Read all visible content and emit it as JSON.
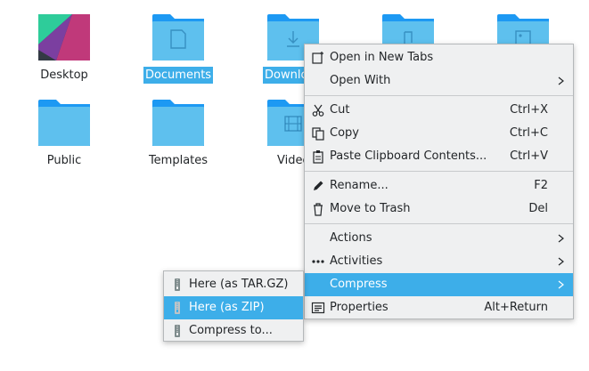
{
  "files": [
    {
      "name": "Desktop",
      "selected": false,
      "kind": "desktop"
    },
    {
      "name": "Documents",
      "selected": true,
      "kind": "documents"
    },
    {
      "name": "Downlo",
      "selected": true,
      "kind": "downloads"
    },
    {
      "name": "",
      "selected": false,
      "kind": "music"
    },
    {
      "name": "",
      "selected": false,
      "kind": "pictures"
    },
    {
      "name": "Public",
      "selected": false,
      "kind": "public"
    },
    {
      "name": "Templates",
      "selected": false,
      "kind": "templates"
    },
    {
      "name": "Videc",
      "selected": false,
      "kind": "videos"
    }
  ],
  "context_menu": {
    "items": {
      "open_tabs": {
        "label": "Open in New Tabs",
        "icon": "new-tab-icon"
      },
      "open_with": {
        "label": "Open With",
        "icon": ""
      },
      "cut": {
        "label": "Cut",
        "shortcut": "Ctrl+X",
        "icon": "scissors-icon"
      },
      "copy": {
        "label": "Copy",
        "shortcut": "Ctrl+C",
        "icon": "copy-icon"
      },
      "paste": {
        "label": "Paste Clipboard Contents...",
        "shortcut": "Ctrl+V",
        "icon": "clipboard-icon"
      },
      "rename": {
        "label": "Rename...",
        "shortcut": "F2",
        "icon": "pencil-icon"
      },
      "trash": {
        "label": "Move to Trash",
        "shortcut": "Del",
        "icon": "trash-icon"
      },
      "actions": {
        "label": "Actions",
        "icon": ""
      },
      "activities": {
        "label": "Activities",
        "icon": "activities-icon"
      },
      "compress": {
        "label": "Compress",
        "icon": "",
        "highlighted": true
      },
      "properties": {
        "label": "Properties",
        "shortcut": "Alt+Return",
        "icon": "properties-icon"
      }
    }
  },
  "compress_submenu": {
    "items": [
      {
        "label": "Here (as TAR.GZ)",
        "icon": "archive-icon",
        "highlighted": false
      },
      {
        "label": "Here (as ZIP)",
        "icon": "archive-icon",
        "highlighted": true
      },
      {
        "label": "Compress to...",
        "icon": "archive-icon",
        "highlighted": false
      }
    ]
  },
  "colors": {
    "accent": "#3daee9",
    "folder_light": "#5ec0ee",
    "folder_dark": "#1d99f3",
    "menu_bg": "#eff0f1"
  }
}
